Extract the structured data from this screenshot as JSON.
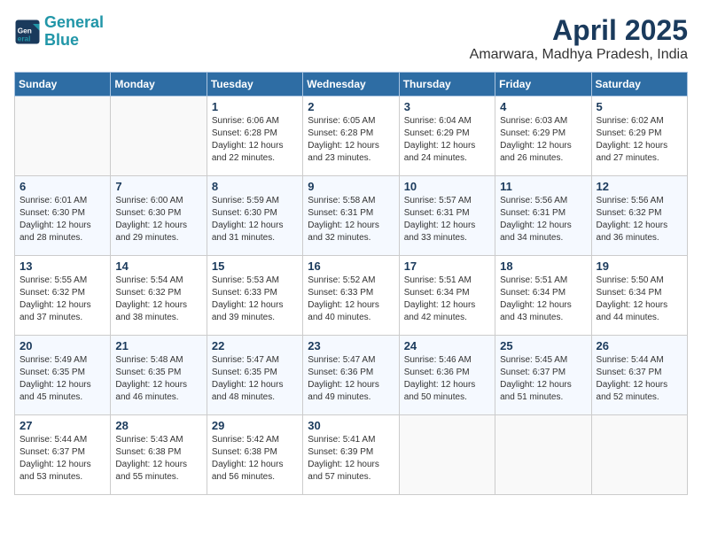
{
  "header": {
    "logo_line1": "General",
    "logo_line2": "Blue",
    "title": "April 2025",
    "subtitle": "Amarwara, Madhya Pradesh, India"
  },
  "days_of_week": [
    "Sunday",
    "Monday",
    "Tuesday",
    "Wednesday",
    "Thursday",
    "Friday",
    "Saturday"
  ],
  "weeks": [
    [
      {
        "day": "",
        "info": ""
      },
      {
        "day": "",
        "info": ""
      },
      {
        "day": "1",
        "info": "Sunrise: 6:06 AM\nSunset: 6:28 PM\nDaylight: 12 hours and 22 minutes."
      },
      {
        "day": "2",
        "info": "Sunrise: 6:05 AM\nSunset: 6:28 PM\nDaylight: 12 hours and 23 minutes."
      },
      {
        "day": "3",
        "info": "Sunrise: 6:04 AM\nSunset: 6:29 PM\nDaylight: 12 hours and 24 minutes."
      },
      {
        "day": "4",
        "info": "Sunrise: 6:03 AM\nSunset: 6:29 PM\nDaylight: 12 hours and 26 minutes."
      },
      {
        "day": "5",
        "info": "Sunrise: 6:02 AM\nSunset: 6:29 PM\nDaylight: 12 hours and 27 minutes."
      }
    ],
    [
      {
        "day": "6",
        "info": "Sunrise: 6:01 AM\nSunset: 6:30 PM\nDaylight: 12 hours and 28 minutes."
      },
      {
        "day": "7",
        "info": "Sunrise: 6:00 AM\nSunset: 6:30 PM\nDaylight: 12 hours and 29 minutes."
      },
      {
        "day": "8",
        "info": "Sunrise: 5:59 AM\nSunset: 6:30 PM\nDaylight: 12 hours and 31 minutes."
      },
      {
        "day": "9",
        "info": "Sunrise: 5:58 AM\nSunset: 6:31 PM\nDaylight: 12 hours and 32 minutes."
      },
      {
        "day": "10",
        "info": "Sunrise: 5:57 AM\nSunset: 6:31 PM\nDaylight: 12 hours and 33 minutes."
      },
      {
        "day": "11",
        "info": "Sunrise: 5:56 AM\nSunset: 6:31 PM\nDaylight: 12 hours and 34 minutes."
      },
      {
        "day": "12",
        "info": "Sunrise: 5:56 AM\nSunset: 6:32 PM\nDaylight: 12 hours and 36 minutes."
      }
    ],
    [
      {
        "day": "13",
        "info": "Sunrise: 5:55 AM\nSunset: 6:32 PM\nDaylight: 12 hours and 37 minutes."
      },
      {
        "day": "14",
        "info": "Sunrise: 5:54 AM\nSunset: 6:32 PM\nDaylight: 12 hours and 38 minutes."
      },
      {
        "day": "15",
        "info": "Sunrise: 5:53 AM\nSunset: 6:33 PM\nDaylight: 12 hours and 39 minutes."
      },
      {
        "day": "16",
        "info": "Sunrise: 5:52 AM\nSunset: 6:33 PM\nDaylight: 12 hours and 40 minutes."
      },
      {
        "day": "17",
        "info": "Sunrise: 5:51 AM\nSunset: 6:34 PM\nDaylight: 12 hours and 42 minutes."
      },
      {
        "day": "18",
        "info": "Sunrise: 5:51 AM\nSunset: 6:34 PM\nDaylight: 12 hours and 43 minutes."
      },
      {
        "day": "19",
        "info": "Sunrise: 5:50 AM\nSunset: 6:34 PM\nDaylight: 12 hours and 44 minutes."
      }
    ],
    [
      {
        "day": "20",
        "info": "Sunrise: 5:49 AM\nSunset: 6:35 PM\nDaylight: 12 hours and 45 minutes."
      },
      {
        "day": "21",
        "info": "Sunrise: 5:48 AM\nSunset: 6:35 PM\nDaylight: 12 hours and 46 minutes."
      },
      {
        "day": "22",
        "info": "Sunrise: 5:47 AM\nSunset: 6:35 PM\nDaylight: 12 hours and 48 minutes."
      },
      {
        "day": "23",
        "info": "Sunrise: 5:47 AM\nSunset: 6:36 PM\nDaylight: 12 hours and 49 minutes."
      },
      {
        "day": "24",
        "info": "Sunrise: 5:46 AM\nSunset: 6:36 PM\nDaylight: 12 hours and 50 minutes."
      },
      {
        "day": "25",
        "info": "Sunrise: 5:45 AM\nSunset: 6:37 PM\nDaylight: 12 hours and 51 minutes."
      },
      {
        "day": "26",
        "info": "Sunrise: 5:44 AM\nSunset: 6:37 PM\nDaylight: 12 hours and 52 minutes."
      }
    ],
    [
      {
        "day": "27",
        "info": "Sunrise: 5:44 AM\nSunset: 6:37 PM\nDaylight: 12 hours and 53 minutes."
      },
      {
        "day": "28",
        "info": "Sunrise: 5:43 AM\nSunset: 6:38 PM\nDaylight: 12 hours and 55 minutes."
      },
      {
        "day": "29",
        "info": "Sunrise: 5:42 AM\nSunset: 6:38 PM\nDaylight: 12 hours and 56 minutes."
      },
      {
        "day": "30",
        "info": "Sunrise: 5:41 AM\nSunset: 6:39 PM\nDaylight: 12 hours and 57 minutes."
      },
      {
        "day": "",
        "info": ""
      },
      {
        "day": "",
        "info": ""
      },
      {
        "day": "",
        "info": ""
      }
    ]
  ]
}
